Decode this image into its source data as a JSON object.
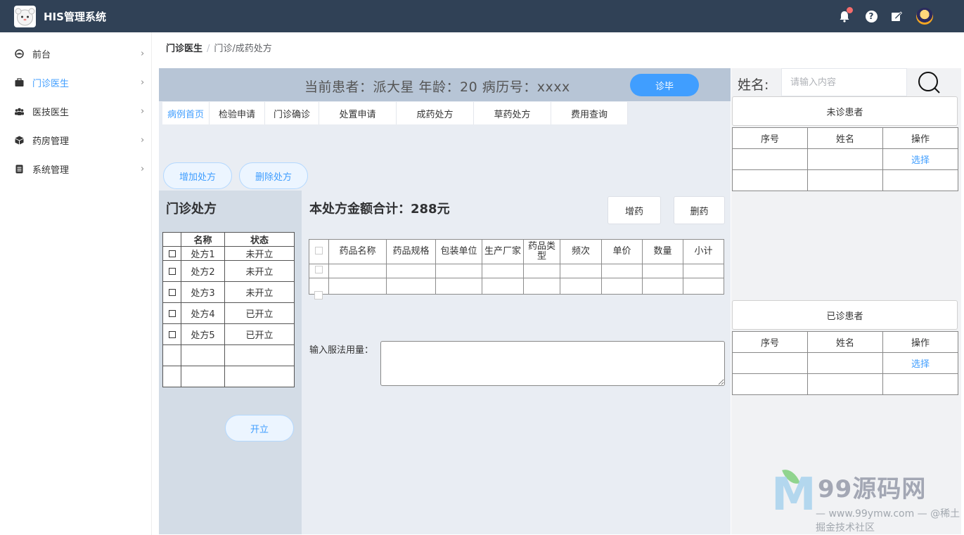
{
  "header": {
    "app_title": "HIS管理系统",
    "icons": [
      "bell-icon",
      "help-icon",
      "edit-icon",
      "user-avatar"
    ]
  },
  "sidebar": {
    "items": [
      {
        "label": "前台",
        "icon": "dashboard-icon",
        "active": false
      },
      {
        "label": "门诊医生",
        "icon": "briefcase-icon",
        "active": true
      },
      {
        "label": "医技医生",
        "icon": "users-icon",
        "active": false
      },
      {
        "label": "药房管理",
        "icon": "box-icon",
        "active": false
      },
      {
        "label": "系统管理",
        "icon": "document-icon",
        "active": false
      }
    ]
  },
  "breadcrumb": {
    "parent": "门诊医生",
    "separator": "/",
    "current": "门诊/成药处方"
  },
  "patient": {
    "info": "当前患者：派大星  年龄：20  病历号：xxxx",
    "finish_label": "诊毕"
  },
  "tabs": [
    {
      "label": "病例首页",
      "active": true
    },
    {
      "label": "检验申请",
      "active": false
    },
    {
      "label": "门诊确诊",
      "active": false
    },
    {
      "label": "处置申请",
      "active": false
    },
    {
      "label": "成药处方",
      "active": false
    },
    {
      "label": "草药处方",
      "active": false
    },
    {
      "label": "费用查询",
      "active": false
    }
  ],
  "actions": {
    "add_rx": "增加处方",
    "delete_rx": "删除处方",
    "open": "开立"
  },
  "prescription_list": {
    "title": "门诊处方",
    "headers": [
      "",
      "名称",
      "状态"
    ],
    "rows": [
      {
        "name": "处方1",
        "status": "未开立"
      },
      {
        "name": "处方2",
        "status": "未开立"
      },
      {
        "name": "处方3",
        "status": "未开立"
      },
      {
        "name": "处方4",
        "status": "已开立"
      },
      {
        "name": "处方5",
        "status": "已开立"
      }
    ]
  },
  "drug_panel": {
    "total": "本处方金额合计：288元",
    "add_drug": "增药",
    "delete_drug": "删药",
    "headers": [
      "药品名称",
      "药品规格",
      "包装单位",
      "生产厂家",
      "药品类型",
      "频次",
      "单价",
      "数量",
      "小计"
    ],
    "dosage_label": "输入服法用量："
  },
  "patients_panel": {
    "name_label": "姓名:",
    "search_placeholder": "请输入内容",
    "pending_label": "未诊患者",
    "done_label": "已诊患者",
    "headers": [
      "序号",
      "姓名",
      "操作"
    ],
    "select_label": "选择"
  },
  "watermark": {
    "logo_letter": "M",
    "brand": "99源码网",
    "sub": "— www.99ymw.com — @稀土掘金技术社区"
  },
  "colors": {
    "header_bg": "#304156",
    "accent": "#409eff",
    "patient_bar": "#b7c5d6",
    "panel_bg": "#e9edf3",
    "left_panel_bg": "#d3dce6"
  }
}
